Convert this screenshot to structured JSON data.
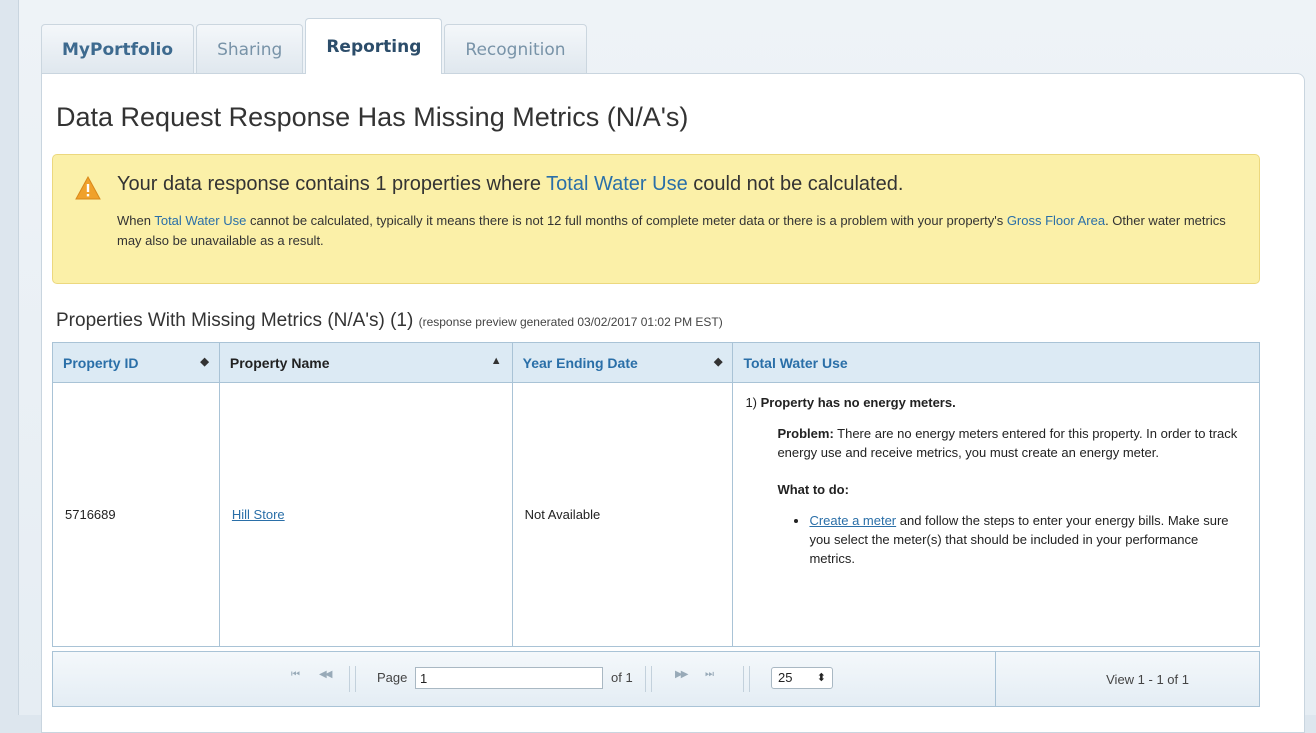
{
  "tabs": [
    {
      "label": "MyPortfolio"
    },
    {
      "label": "Sharing"
    },
    {
      "label": "Reporting"
    },
    {
      "label": "Recognition"
    }
  ],
  "page_title": "Data Request Response Has Missing Metrics (N/A's)",
  "alert": {
    "headline_pre": "Your data response contains 1 properties where ",
    "headline_metric": "Total Water Use",
    "headline_post": " could not be calculated.",
    "body_pre": "When ",
    "body_metric": "Total Water Use",
    "body_mid": " cannot be calculated, typically it means there is not 12 full months of complete meter data or there is a problem with your property's ",
    "body_gfa": "Gross Floor Area",
    "body_post": ". Other water metrics may also be unavailable as a result."
  },
  "section": {
    "title": "Properties With Missing Metrics (N/A's) (1)",
    "note": "(response preview generated 03/02/2017 01:02 PM EST)"
  },
  "table": {
    "headers": [
      "Property ID",
      "Property Name",
      "Year Ending Date",
      "Total Water Use"
    ],
    "sort_icons": [
      "◆",
      "▲",
      "◆"
    ],
    "row": {
      "property_id": "5716689",
      "property_name": "Hill Store",
      "year_ending": "Not Available",
      "issue_number": "1)",
      "issue_title": "Property has no energy meters.",
      "problem_label": "Problem:",
      "problem_text": " There are no energy meters entered for this property. In order to track energy use and receive metrics, you must create an energy meter.",
      "what_to_do": "What to do:",
      "action_link": "Create a meter",
      "action_text": " and follow the steps to enter your energy bills. Make sure you select the meter(s) that should be included in your performance metrics."
    }
  },
  "pager": {
    "first": "⏮",
    "prev": "◀◀",
    "next": "▶▶",
    "last": "⏭",
    "page_label": "Page",
    "page_value": "1",
    "of_label": "of 1",
    "page_size": "25",
    "size_arrow": "⬍",
    "view_text": "View 1 - 1 of 1"
  }
}
